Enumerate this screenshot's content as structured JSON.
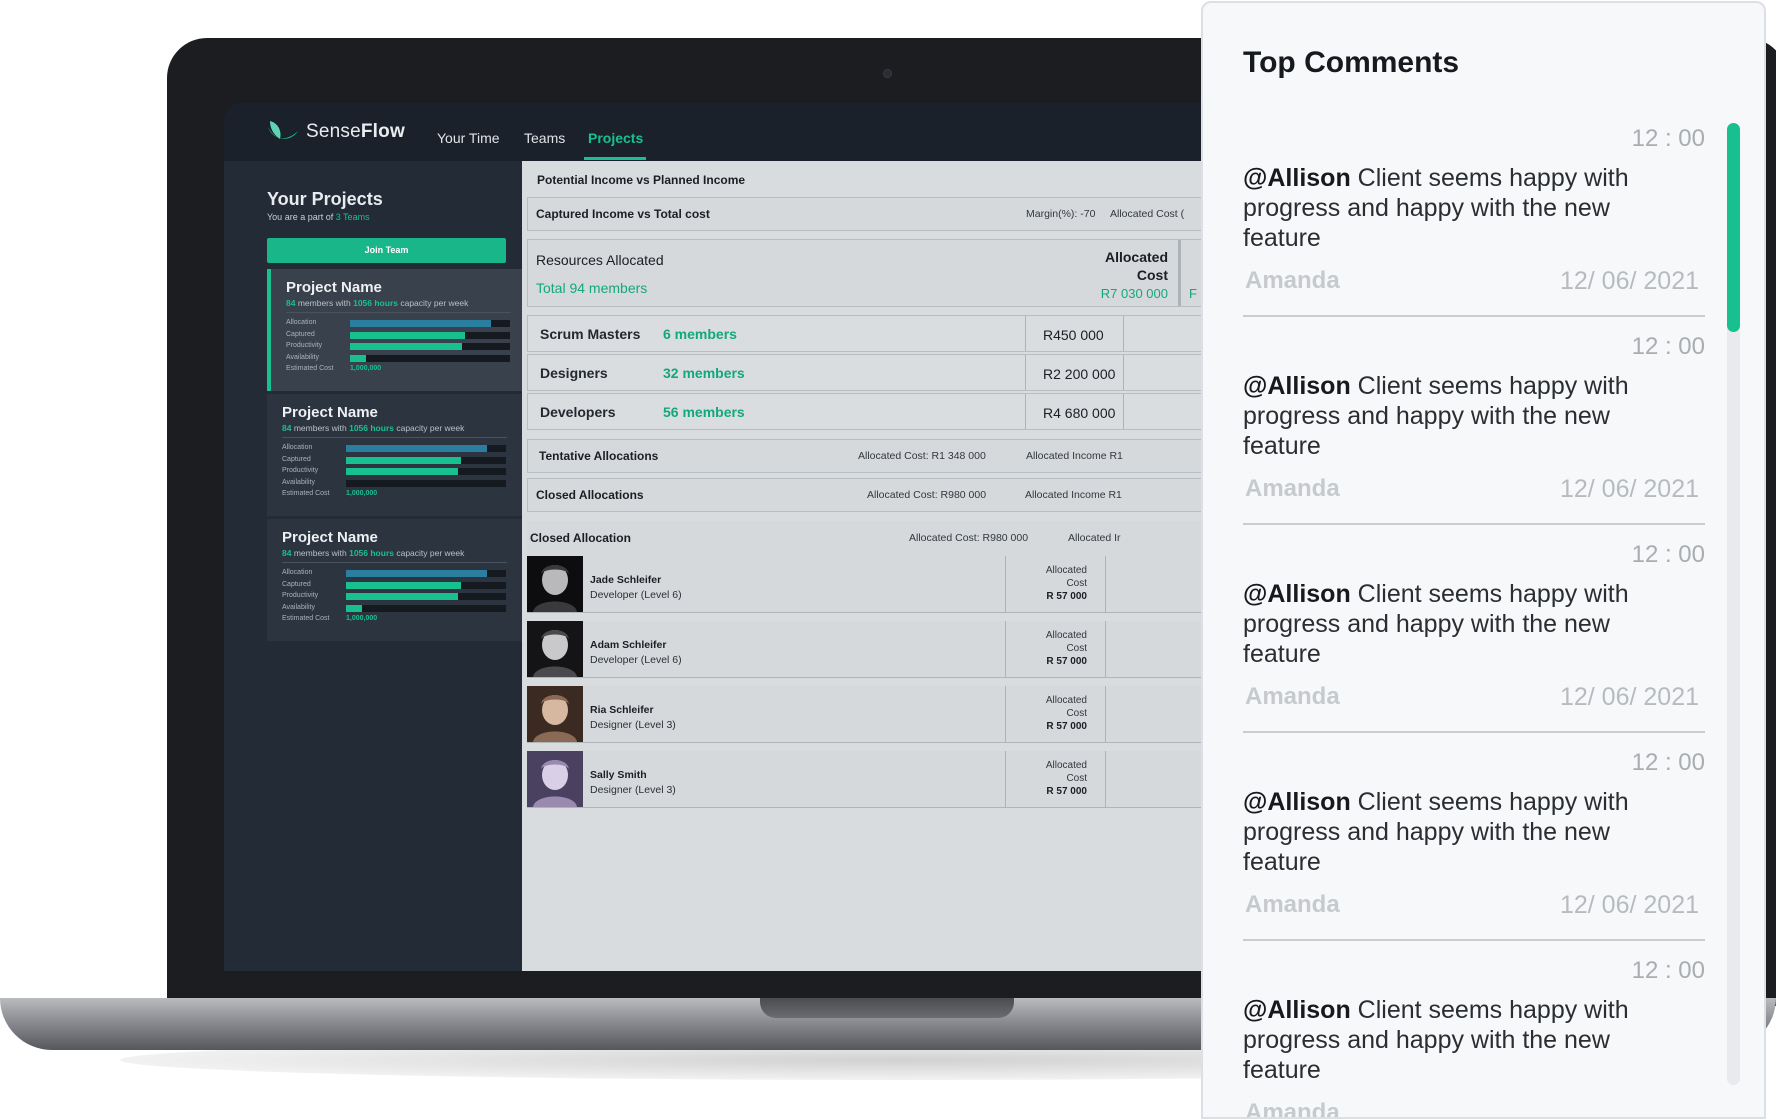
{
  "app": {
    "brand_light": "Sense",
    "brand_bold": "Flow",
    "nav": [
      "Your Time",
      "Teams",
      "Projects"
    ],
    "accent": "#19c08f"
  },
  "sidebar": {
    "title": "Your Projects",
    "subtitle_prefix": "You are a part of ",
    "subtitle_teams": "3 Teams",
    "join_label": "Join Team",
    "metric_labels": [
      "Allocation",
      "Captured",
      "Productivity",
      "Availability",
      "Estimated Cost"
    ],
    "projects": [
      {
        "name": "Project Name",
        "members": "84",
        "members_text": " members with ",
        "hours": "1056 hours",
        "hours_text": " capacity per week",
        "est": "1,000,000",
        "bars": [
          {
            "fill": 0.88,
            "color": "#2a7fa0"
          },
          {
            "fill": 0.72,
            "color": "#19c08f"
          },
          {
            "fill": 0.7,
            "color": "#19c08f"
          },
          {
            "fill": 0.1,
            "color": "#19c08f"
          }
        ]
      },
      {
        "name": "Project Name",
        "members": "84",
        "members_text": " members with ",
        "hours": "1056 hours",
        "hours_text": " capacity per week",
        "est": "1,000,000",
        "bars": [
          {
            "fill": 0.88,
            "color": "#2a7fa0"
          },
          {
            "fill": 0.72,
            "color": "#19c08f"
          },
          {
            "fill": 0.7,
            "color": "#19c08f"
          },
          {
            "fill": 0.0,
            "color": "#19c08f"
          }
        ]
      },
      {
        "name": "Project Name",
        "members": "84",
        "members_text": " members with ",
        "hours": "1056 hours",
        "hours_text": " capacity per week",
        "est": "1,000,000",
        "bars": [
          {
            "fill": 0.88,
            "color": "#2a7fa0"
          },
          {
            "fill": 0.72,
            "color": "#19c08f"
          },
          {
            "fill": 0.7,
            "color": "#19c08f"
          },
          {
            "fill": 0.1,
            "color": "#19c08f"
          }
        ]
      }
    ]
  },
  "main": {
    "heading": "Potential Income vs Planned Income",
    "captured": {
      "title": "Captured Income vs Total cost",
      "margin": "Margin(%): -70",
      "alloc_cost": "Allocated Cost ("
    },
    "resources": {
      "title": "Resources  Allocated",
      "total": "Total 94 members",
      "cost_label_1": "Allocated",
      "cost_label_2": "Cost",
      "cost_value": "R7 030 000",
      "trail": "F"
    },
    "roles": [
      {
        "name": "Scrum Masters",
        "count": "6 members",
        "cost": "R450 000"
      },
      {
        "name": "Designers",
        "count": "32 members",
        "cost": "R2 200 000"
      },
      {
        "name": "Developers",
        "count": "56 members",
        "cost": "R4 680 000"
      }
    ],
    "tentative": {
      "title": "Tentative  Allocations",
      "cost": "Allocated Cost: R1 348 000",
      "income": "Allocated Income R1"
    },
    "closed_1": {
      "title": "Closed  Allocations",
      "cost": "Allocated Cost: R980 000",
      "income": "Allocated Income R1"
    },
    "closed_2": {
      "title": "Closed  Allocation",
      "cost": "Allocated Cost: R980 000",
      "income": "Allocated Ir"
    },
    "people": [
      {
        "name": "Jade Schleifer",
        "role": "Developer (Level 6)",
        "label1": "Allocated",
        "label2": "Cost",
        "cost": "R 57 000"
      },
      {
        "name": "Adam Schleifer",
        "role": "Developer (Level 6)",
        "label1": "Allocated",
        "label2": "Cost",
        "cost": "R 57 000"
      },
      {
        "name": "Ria Schleifer",
        "role": "Designer (Level 3)",
        "label1": "Allocated",
        "label2": "Cost",
        "cost": "R 57 000"
      },
      {
        "name": "Sally Smith",
        "role": "Designer (Level 3)",
        "label1": "Allocated",
        "label2": "Cost",
        "cost": "R 57 000"
      }
    ]
  },
  "comments_panel": {
    "title": "Top Comments",
    "comments": [
      {
        "time": "12 : 00",
        "mention": "@Allison",
        "text": " Client seems happy with progress and happy with the new feature",
        "author": "Amanda",
        "date": "12/ 06/ 2021"
      },
      {
        "time": "12 : 00",
        "mention": "@Allison",
        "text": " Client seems happy with progress and happy with the new feature",
        "author": "Amanda",
        "date": "12/ 06/ 2021"
      },
      {
        "time": "12 : 00",
        "mention": "@Allison",
        "text": " Client seems happy with progress and happy with the new feature",
        "author": "Amanda",
        "date": "12/ 06/ 2021"
      },
      {
        "time": "12 : 00",
        "mention": "@Allison",
        "text": " Client seems happy with progress and happy with the new feature",
        "author": "Amanda",
        "date": "12/ 06/ 2021"
      },
      {
        "time": "12 : 00",
        "mention": "@Allison",
        "text": " Client seems happy with progress and happy with the new feature",
        "author": "Amanda",
        "date": ""
      }
    ]
  }
}
